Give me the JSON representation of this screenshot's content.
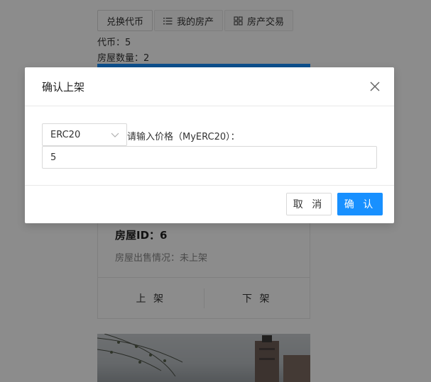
{
  "tabs": [
    {
      "label": "兑换代币",
      "icon": ""
    },
    {
      "label": "我的房产",
      "icon": "list-icon"
    },
    {
      "label": "房产交易",
      "icon": "grid-icon"
    }
  ],
  "account": {
    "tokens_line": "代币：5",
    "houses_line": "房屋数量：2"
  },
  "card": {
    "house_id": "房屋ID：6",
    "sale_status": "房屋出售情况：未上架",
    "list_label": "上 架",
    "unlist_label": "下 架"
  },
  "modal": {
    "title": "确认上架",
    "token_selected": "ERC20",
    "price_label": "请输入价格（MyERC20）：",
    "price_value": "5",
    "cancel_label": "取 消",
    "ok_label": "确 认"
  },
  "colors": {
    "primary": "#1890ff",
    "mask": "rgba(0,0,0,0.45)"
  }
}
